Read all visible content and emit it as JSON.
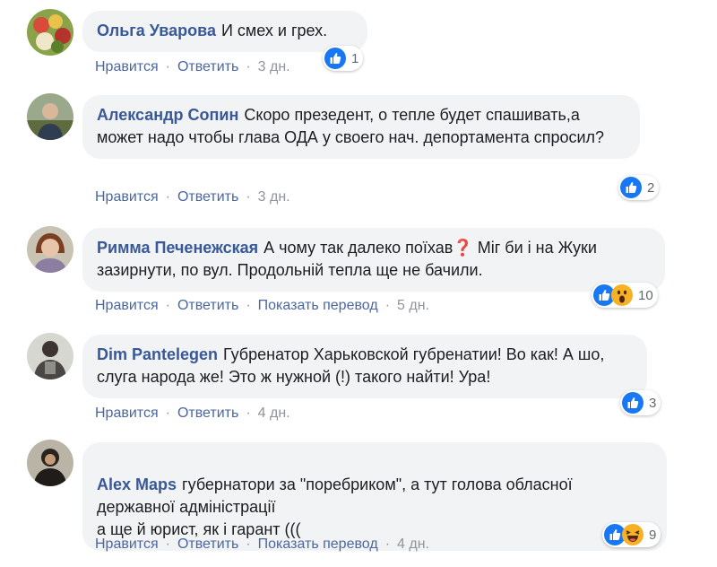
{
  "actions": {
    "like": "Нравится",
    "reply": "Ответить",
    "translate": "Показать перевод",
    "separator": "·"
  },
  "colors": {
    "author": "#385898",
    "link": "#4b67a1",
    "bubble": "#f2f3f5",
    "like": "#1877f2",
    "reaction_yellow": "#f7b125"
  },
  "comments": [
    {
      "author": "Ольга Уварова",
      "text": "И смех и грех.",
      "time": "3 дн.",
      "reactions": [
        "like-icon"
      ],
      "count": "1"
    },
    {
      "author": "Александр Сопин",
      "text": "Скоро презедент, о тепле будет спашивать,а может надо чтобы глава ОДА у своего нач. депортамента спросил?",
      "time": "3 дн.",
      "reactions": [
        "like-icon"
      ],
      "count": "2"
    },
    {
      "author": "Римма Печенежская",
      "text": "А чому так далеко поїхав❓ Міг би і на Жуки зазирнути, по вул. Продольній тепла ще не бачили.",
      "time": "5 дн.",
      "reactions": [
        "like-icon",
        "wow-icon"
      ],
      "count": "10"
    },
    {
      "author": "Dim Pantelegen",
      "text": "Губренатор Харьковской губренатии! Во как! А шо, слуга народа же! Это ж нужной (!) такого найти! Ура!",
      "time": "4 дн.",
      "reactions": [
        "like-icon"
      ],
      "count": "3"
    },
    {
      "author": "Alex Maps",
      "text": "губернатори за \"поребриком\", а тут голова обласної державної адміністрації\nа ще й юрист, як і гарант (((",
      "time": "4 дн.",
      "reactions": [
        "like-icon",
        "haha-icon"
      ],
      "count": "9"
    }
  ]
}
